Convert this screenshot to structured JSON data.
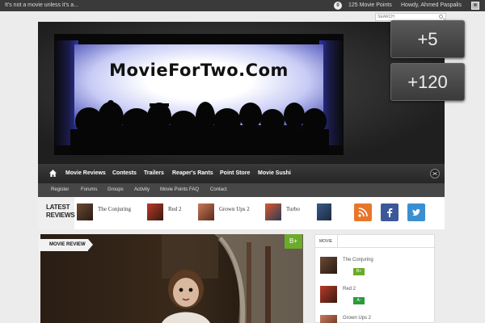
{
  "admin_bar": {
    "site_tagline": "It's not a movie unless it's a...",
    "points_badge": "0",
    "points": "125 Movie Points",
    "greeting": "Howdy, Ahmed Paspalis"
  },
  "search": {
    "placeholder": "SEARCH"
  },
  "header": {
    "logo_text": "MovieForTwo.Com"
  },
  "promos": [
    "+5",
    "+120"
  ],
  "main_nav": [
    "Movie Reviews",
    "Contests",
    "Trailers",
    "Reaper's Rants",
    "Point Store",
    "Movie Sushi"
  ],
  "sub_nav": [
    "Register",
    "Forums",
    "Groups",
    "Activity",
    "Movie Points FAQ",
    "Contact"
  ],
  "latest_reviews": {
    "label_line1": "LATEST",
    "label_line2": "REVIEWS",
    "items": [
      "The Conjuring",
      "Red 2",
      "Grown Ups 2",
      "Turbo"
    ]
  },
  "social_icons": [
    "rss-icon",
    "facebook-icon",
    "twitter-icon"
  ],
  "feature": {
    "category": "MOVIE REVIEW",
    "grade": "B+"
  },
  "sidebar": {
    "tab": "MOVIE",
    "items": [
      {
        "title": "The Conjuring",
        "grade": "B+"
      },
      {
        "title": "Red 2",
        "grade": "A-"
      },
      {
        "title": "Grown Ups 2",
        "grade": ""
      }
    ]
  },
  "colors": {
    "grade_green": "#6bab2a",
    "grade_green_alt": "#2a9b3a",
    "rss_orange": "#e8762a",
    "facebook_blue": "#3b5998",
    "twitter_blue": "#3a8fd1",
    "admin_bar": "#3a3a3a"
  }
}
